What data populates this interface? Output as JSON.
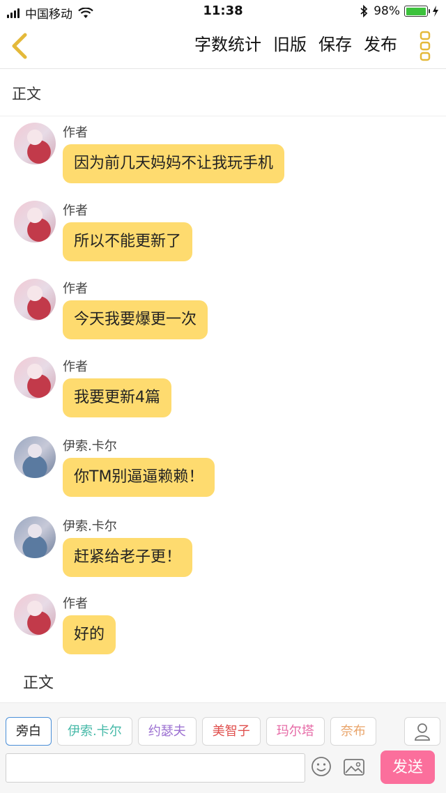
{
  "status_bar": {
    "carrier": "中国移动",
    "time": "11:38",
    "battery": "98%",
    "battery_level": 0.98,
    "battery_color": "#3cc23c"
  },
  "nav": {
    "actions": [
      "字数统计",
      "旧版",
      "保存",
      "发布"
    ],
    "icons": [
      "chevron-left-icon",
      "more-vertical-icon"
    ],
    "accent_color": "#e4b93a"
  },
  "section_top": "正文",
  "messages": [
    {
      "sender": "作者",
      "text": "因为前几天妈妈不让我玩手机",
      "avatar": "author"
    },
    {
      "sender": "作者",
      "text": "所以不能更新了",
      "avatar": "author"
    },
    {
      "sender": "作者",
      "text": "今天我要爆更一次",
      "avatar": "author"
    },
    {
      "sender": "作者",
      "text": "我要更新4篇",
      "avatar": "author"
    },
    {
      "sender": "伊索.卡尔",
      "text": "你TM别逼逼赖赖！",
      "avatar": "isocarl"
    },
    {
      "sender": "伊索.卡尔",
      "text": "赶紧给老子更！",
      "avatar": "isocarl"
    },
    {
      "sender": "作者",
      "text": "好的",
      "avatar": "author"
    }
  ],
  "bubble_color": "#fedb6f",
  "section_bottom": "正文",
  "roles": [
    {
      "label": "旁白",
      "color": "#222222",
      "active": true
    },
    {
      "label": "伊索.卡尔",
      "color": "#46b9a8",
      "active": false
    },
    {
      "label": "约瑟夫",
      "color": "#9b6fd1",
      "active": false
    },
    {
      "label": "美智子",
      "color": "#e0504e",
      "active": false
    },
    {
      "label": "玛尔塔",
      "color": "#e66aa6",
      "active": false
    },
    {
      "label": "奈布",
      "color": "#e9a46a",
      "active": false
    }
  ],
  "input": {
    "value": "",
    "send_label": "发送",
    "send_color": "#fb6f9c"
  }
}
